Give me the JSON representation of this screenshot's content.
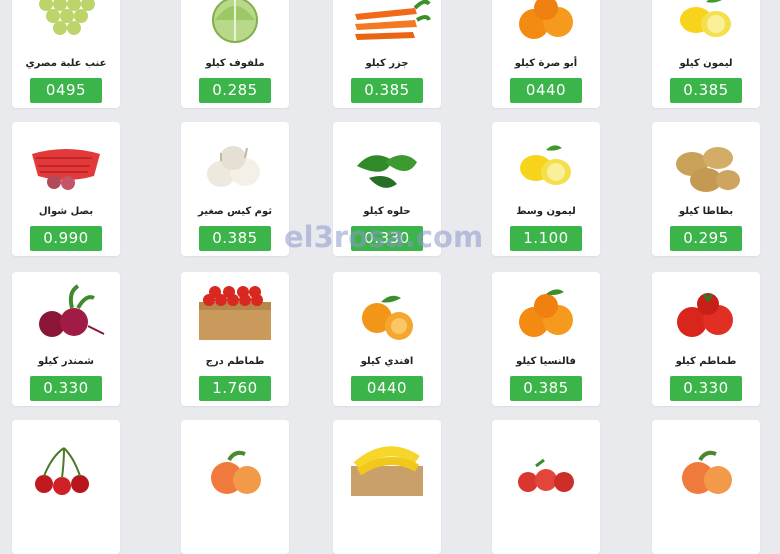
{
  "watermark": "el3rosa.com",
  "colors": {
    "price_bg": "#3bb44a",
    "card_bg": "#ffffff",
    "page_bg": "#e9eaee"
  },
  "products": [
    {
      "name": "ليمون كيلو",
      "price": "0.385",
      "icon": "lemon-icon"
    },
    {
      "name": "أبو صرة كيلو",
      "price": "0440",
      "icon": "orange-icon"
    },
    {
      "name": "جزر كيلو",
      "price": "0.385",
      "icon": "carrot-icon"
    },
    {
      "name": "ملفوف كيلو",
      "price": "0.285",
      "icon": "cabbage-icon"
    },
    {
      "name": "عنب علبة مصري",
      "price": "0495",
      "icon": "grapes-icon"
    },
    {
      "name": "بطاطا كيلو",
      "price": "0.295",
      "icon": "potato-icon"
    },
    {
      "name": "ليمون وسط",
      "price": "1.100",
      "icon": "lemon-icon"
    },
    {
      "name": "حلوه كيلو",
      "price": "0.330",
      "icon": "pepper-icon"
    },
    {
      "name": "ثوم كيس صغير",
      "price": "0.385",
      "icon": "garlic-icon"
    },
    {
      "name": "بصل شوال",
      "price": "0.990",
      "icon": "onion-sack-icon"
    },
    {
      "name": "طماطم كيلو",
      "price": "0.330",
      "icon": "tomato-icon"
    },
    {
      "name": "فالنسيا كيلو",
      "price": "0.385",
      "icon": "orange-icon"
    },
    {
      "name": "افندي كيلو",
      "price": "0440",
      "icon": "tangerine-icon"
    },
    {
      "name": "طماطم درج",
      "price": "1.760",
      "icon": "tomato-crate-icon"
    },
    {
      "name": "شمندر كيلو",
      "price": "0.330",
      "icon": "beetroot-icon"
    },
    {
      "name": "",
      "price": "",
      "icon": "peach-icon"
    },
    {
      "name": "",
      "price": "",
      "icon": "plum-icon"
    },
    {
      "name": "",
      "price": "",
      "icon": "banana-crate-icon"
    },
    {
      "name": "",
      "price": "",
      "icon": "peach-icon"
    },
    {
      "name": "",
      "price": "",
      "icon": "cherry-icon"
    }
  ]
}
